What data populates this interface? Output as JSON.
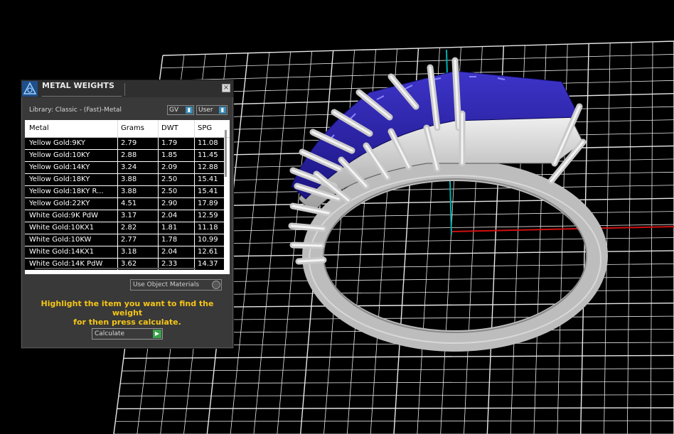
{
  "dialog": {
    "title": "METAL WEIGHTS",
    "close_glyph": "×",
    "library_label": "Library: Classic - (Fast)-Metal",
    "gv_select": "GV",
    "user_select": "User",
    "use_object_materials": "Use Object Materials",
    "instruction_line1": "Highlight the item you want to find the weight",
    "instruction_line2": "for then press calculate.",
    "calculate_label": "Calculate"
  },
  "table": {
    "headers": [
      "Metal",
      "Grams",
      "DWT",
      "SPG"
    ],
    "rows": [
      [
        "Yellow Gold:9KY",
        "2.79",
        "1.79",
        "11.08"
      ],
      [
        "Yellow Gold:10KY",
        "2.88",
        "1.85",
        "11.45"
      ],
      [
        "Yellow Gold:14KY",
        "3.24",
        "2.09",
        "12.88"
      ],
      [
        "Yellow Gold:18KY",
        "3.88",
        "2.50",
        "15.41"
      ],
      [
        "Yellow Gold:18KY R...",
        "3.88",
        "2.50",
        "15.41"
      ],
      [
        "Yellow Gold:22KY",
        "4.51",
        "2.90",
        "17.89"
      ],
      [
        "White Gold:9K PdW",
        "3.17",
        "2.04",
        "12.59"
      ],
      [
        "White Gold:10KX1",
        "2.82",
        "1.81",
        "11.18"
      ],
      [
        "White Gold:10KW",
        "2.77",
        "1.78",
        "10.99"
      ],
      [
        "White Gold:14KX1",
        "3.18",
        "2.04",
        "12.61"
      ],
      [
        "White Gold:14K PdW",
        "3.62",
        "2.33",
        "14.37"
      ]
    ]
  },
  "colors": {
    "highlight_text": "#f5c518",
    "stone_blue": "#2a1fa8",
    "axis_x": "#d01010",
    "axis_y": "#00b0b0",
    "grid_line": "#e8e8e8"
  },
  "icons": {
    "app_logo": "rhino-logo-icon",
    "close": "close-icon",
    "dropdown": "dropdown-arrow-icon",
    "calculate": "play-arrow-icon"
  }
}
